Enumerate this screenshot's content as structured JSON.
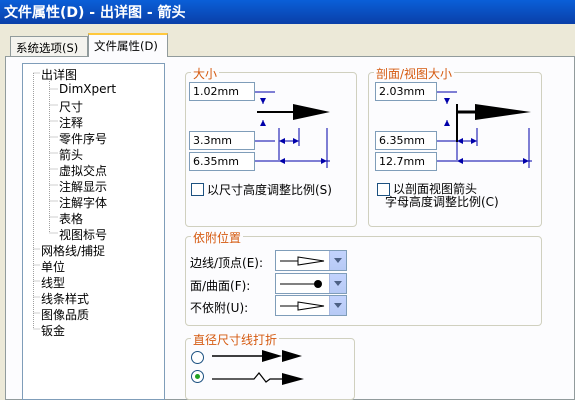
{
  "window": {
    "title": "文件属性(D) - 出详图 - 箭头"
  },
  "tabs": [
    {
      "label": "系统选项(S)"
    },
    {
      "label": "文件属性(D)"
    }
  ],
  "tree": {
    "items": [
      {
        "label": "出详图"
      },
      {
        "label": "DimXpert"
      },
      {
        "label": "尺寸"
      },
      {
        "label": "注释"
      },
      {
        "label": "零件序号"
      },
      {
        "label": "箭头"
      },
      {
        "label": "虚拟交点"
      },
      {
        "label": "注解显示"
      },
      {
        "label": "注解字体"
      },
      {
        "label": "表格"
      },
      {
        "label": "视图标号"
      },
      {
        "label": "网格线/捕捉"
      },
      {
        "label": "单位"
      },
      {
        "label": "线型"
      },
      {
        "label": "线条样式"
      },
      {
        "label": "图像品质"
      },
      {
        "label": "钣金"
      }
    ]
  },
  "size_group": {
    "title": "大小",
    "height": "1.02mm",
    "width": "3.3mm",
    "length": "6.35mm",
    "scale_label": "以尺寸高度调整比例(S)"
  },
  "section_group": {
    "title": "剖面/视图大小",
    "height": "2.03mm",
    "width": "6.35mm",
    "length": "12.7mm",
    "scale_label_1": "以剖面视图箭头",
    "scale_label_2": "字母高度调整比例(C)"
  },
  "attach_group": {
    "title": "依附位置",
    "edge_label": "边线/顶点(E):",
    "face_label": "面/曲面(F):",
    "unattached_label": "不依附(U):"
  },
  "break_group": {
    "title": "直径尺寸线打折"
  }
}
